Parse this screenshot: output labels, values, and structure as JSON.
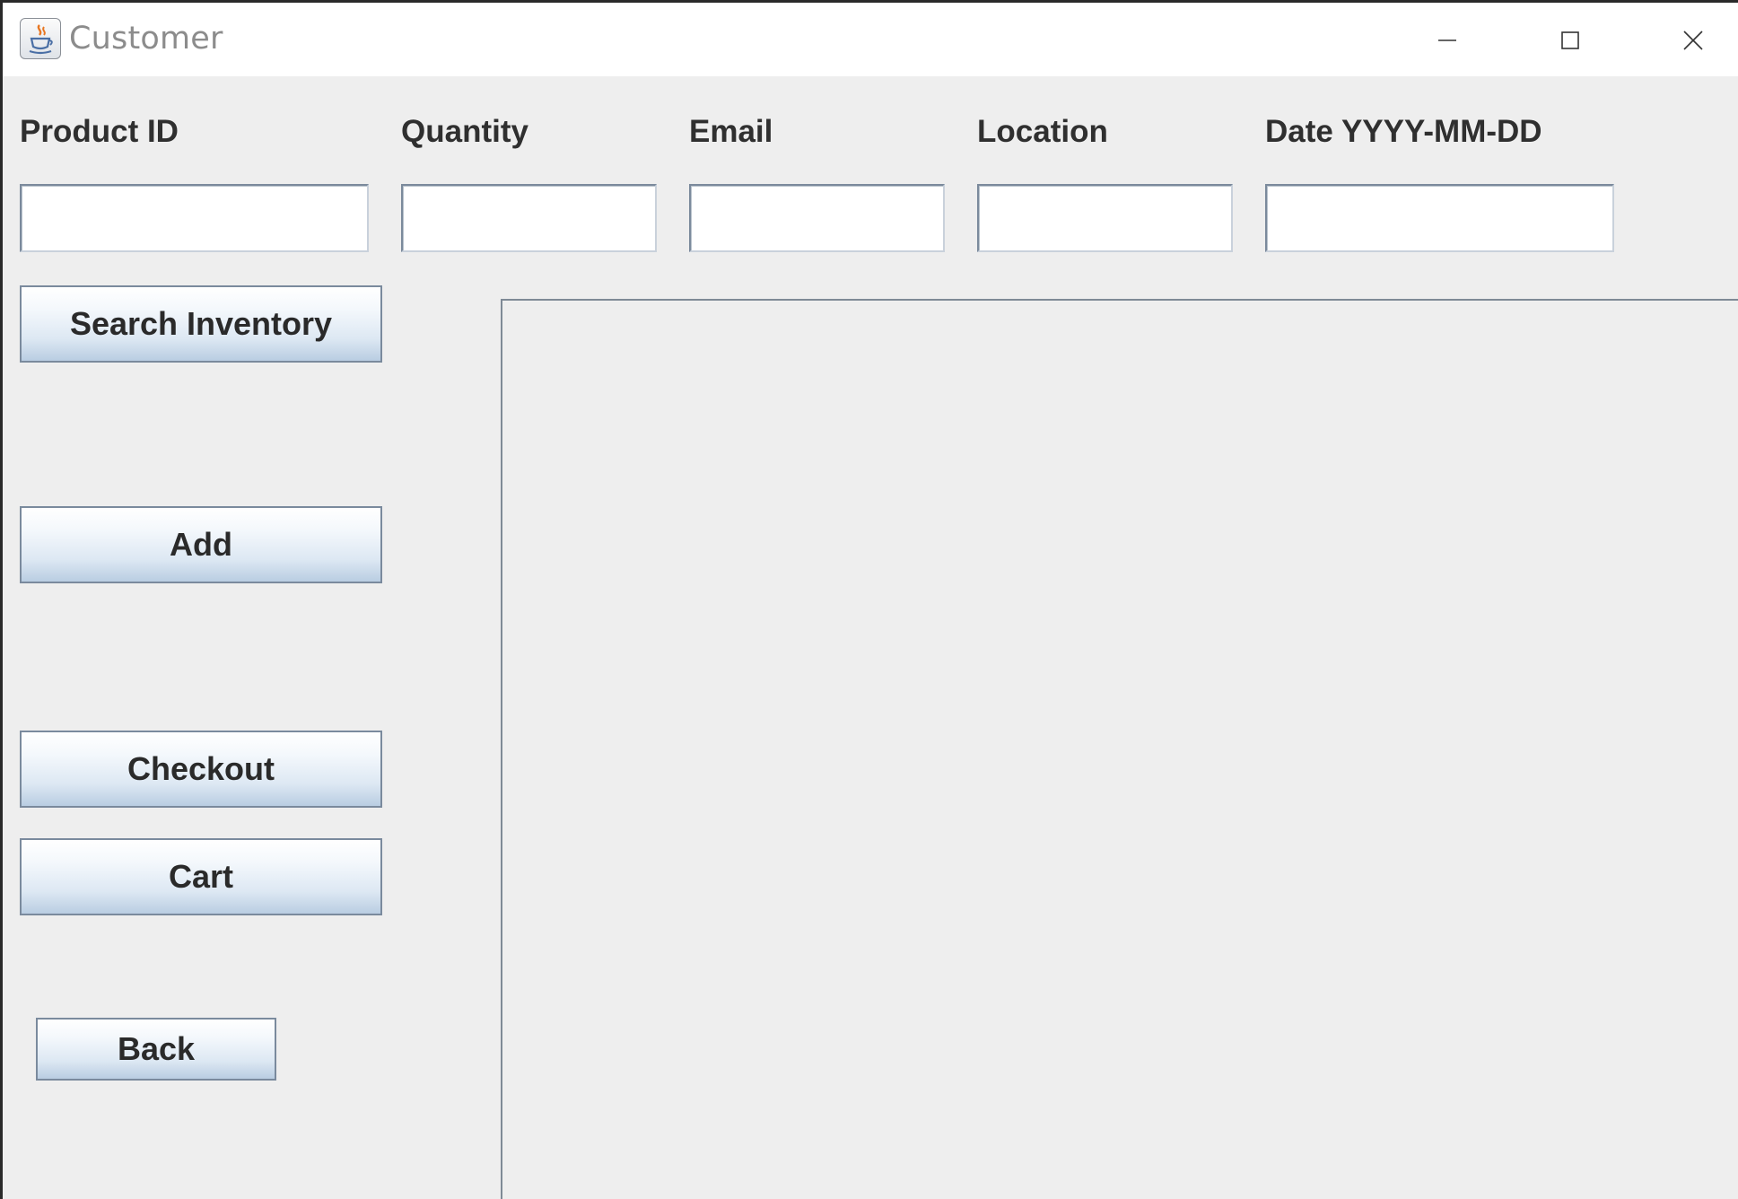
{
  "window": {
    "title": "Customer"
  },
  "form": {
    "labels": {
      "product_id": "Product ID",
      "quantity": "Quantity",
      "email": "Email",
      "location": "Location",
      "date": "Date YYYY-MM-DD"
    },
    "values": {
      "product_id": "",
      "quantity": "",
      "email": "",
      "location": "",
      "date": ""
    }
  },
  "buttons": {
    "search_inventory": "Search Inventory",
    "add": "Add",
    "checkout": "Checkout",
    "cart": "Cart",
    "back": "Back"
  },
  "icons": {
    "app": "java-coffee-cup-icon",
    "minimize": "minimize-icon",
    "maximize": "maximize-icon",
    "close": "close-icon"
  }
}
